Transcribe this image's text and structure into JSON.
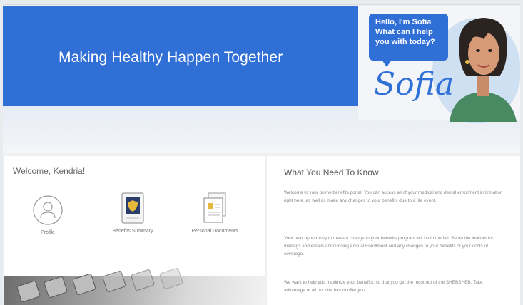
{
  "hero": {
    "title": "Making Healthy Happen Together"
  },
  "assistant": {
    "greeting_lines": [
      "Hello, I'm Sofia",
      "What can I help",
      "you with today?"
    ],
    "name": "Sofia"
  },
  "welcome": {
    "title": "Welcome, Kendria!",
    "tiles": [
      {
        "label": "Profile",
        "icon": "profile-icon"
      },
      {
        "label": "Benefits Summary",
        "icon": "benefits-shield-icon"
      },
      {
        "label": "Personal Documents",
        "icon": "documents-icon"
      }
    ]
  },
  "info": {
    "title": "What You Need To Know",
    "paragraphs": [
      "Welcome to your online benefits portal! You can access all of your medical and dental enrollment information right here, as well as make any changes to your benefits due to a life event.",
      "Your next opportunity to make a change to your benefits program will be in the fall. Be on the lookout for mailings and emails announcing Annual Enrollment and any changes to your benefits or your costs of coverage.",
      "We want to help you maximize your benefits, so that you get the most out of the SHEBSHBB. Take advantage of all our site has to offer you."
    ]
  },
  "colors": {
    "brand_blue": "#2f6fd6",
    "light_blue": "#cfe0f2"
  }
}
